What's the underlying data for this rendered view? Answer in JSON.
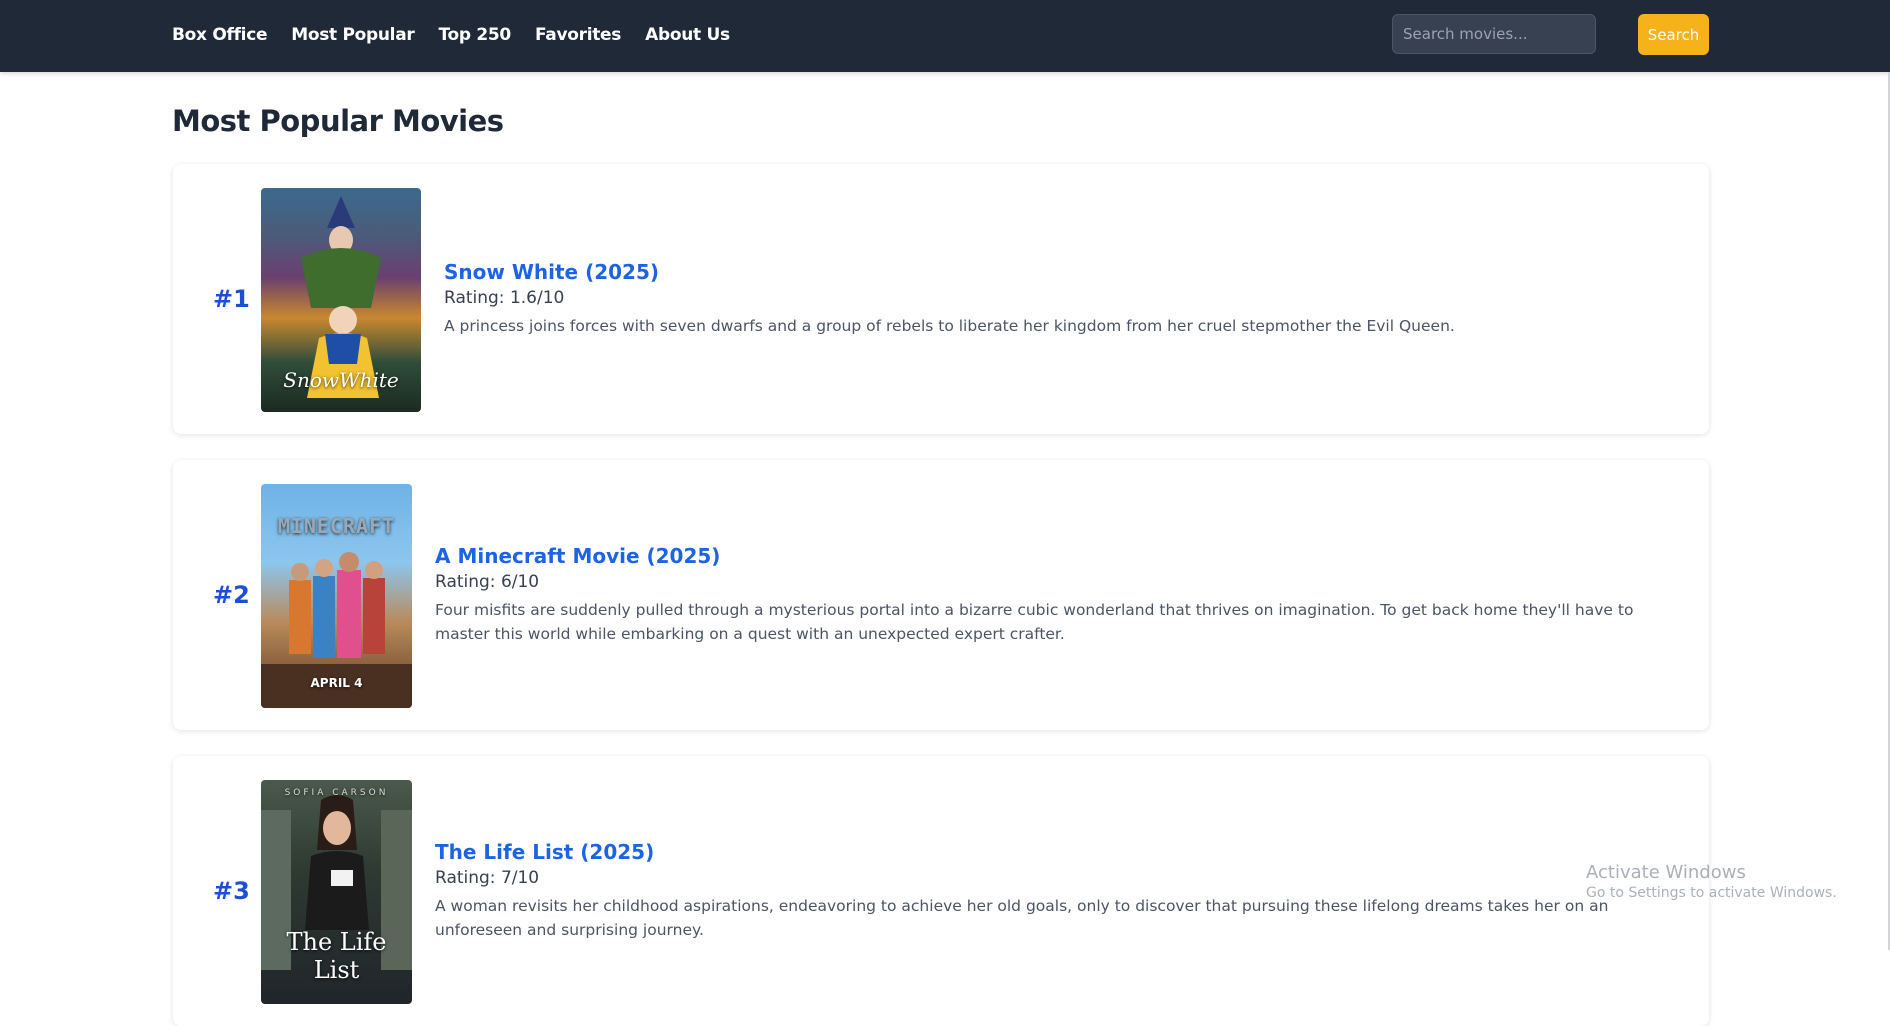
{
  "nav": {
    "links": [
      "Box Office",
      "Most Popular",
      "Top 250",
      "Favorites",
      "About Us"
    ],
    "search_placeholder": "Search movies...",
    "search_button": "Search"
  },
  "page": {
    "title": "Most Popular Movies"
  },
  "movies": [
    {
      "rank": "#1",
      "title": "Snow White (2025)",
      "rating": "Rating: 1.6/10",
      "description": "A princess joins forces with seven dwarfs and a group of rebels to liberate her kingdom from her cruel stepmother the Evil Queen.",
      "poster_text": "SnowWhite",
      "poster_icon": "snow-white-poster"
    },
    {
      "rank": "#2",
      "title": "A Minecraft Movie (2025)",
      "rating": "Rating: 6/10",
      "description": "Four misfits are suddenly pulled through a mysterious portal into a bizarre cubic wonderland that thrives on imagination. To get back home they'll have to master this world while embarking on a quest with an unexpected expert crafter.",
      "poster_text": "MINECRAFT",
      "poster_subtext": "APRIL 4",
      "poster_icon": "minecraft-poster"
    },
    {
      "rank": "#3",
      "title": "The Life List (2025)",
      "rating": "Rating: 7/10",
      "description": "A woman revisits her childhood aspirations, endeavoring to achieve her old goals, only to discover that pursuing these lifelong dreams takes her on an unforeseen and surprising journey.",
      "poster_text": "The Life List",
      "poster_topline": "SOFIA CARSON",
      "poster_icon": "life-list-poster"
    }
  ],
  "watermark": {
    "title": "Activate Windows",
    "subtitle": "Go to Settings to activate Windows."
  }
}
